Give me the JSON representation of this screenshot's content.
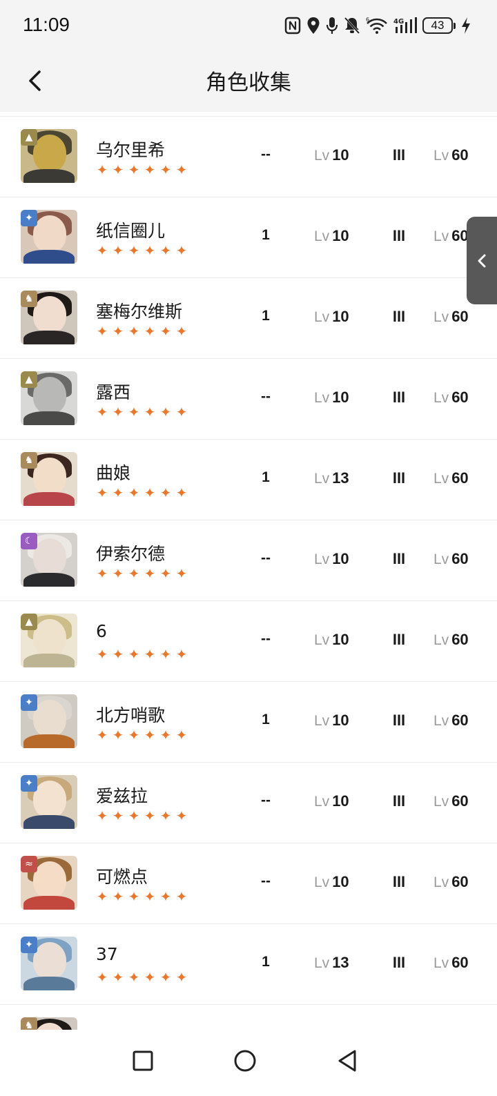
{
  "status_bar": {
    "time": "11:09",
    "battery": "43",
    "icons": [
      "nfc-icon",
      "location-icon",
      "microphone-icon",
      "bell-off-icon",
      "wifi-6-icon",
      "signal-4g-icon",
      "charging-icon"
    ]
  },
  "header": {
    "title": "角色收集",
    "back_icon": "chevron-left-icon"
  },
  "characters": [
    {
      "name": "乌尔里希",
      "stars": "★★★★★★",
      "dup": "--",
      "lv_prefix": "Lv",
      "level": "10",
      "phase": "III",
      "max_prefix": "Lv",
      "max_level": "60",
      "afflatus": "mineral-icon",
      "badge_color": "#9a8a4e",
      "badge_glyph": "▲",
      "bg": "#c9b98a",
      "hair": "#4b4632",
      "skin": "#c9a84a",
      "cloth": "#3b3a35"
    },
    {
      "name": "纸信圈儿",
      "stars": "★★★★★★",
      "dup": "1",
      "lv_prefix": "Lv",
      "level": "10",
      "phase": "III",
      "max_prefix": "Lv",
      "max_level": "60",
      "afflatus": "star-icon",
      "badge_color": "#4a7fc8",
      "badge_glyph": "✦",
      "bg": "#d9c7b8",
      "hair": "#8a5a4a",
      "skin": "#f1d9c8",
      "cloth": "#2f4d8a"
    },
    {
      "name": "塞梅尔维斯",
      "stars": "★★★★★★",
      "dup": "1",
      "lv_prefix": "Lv",
      "level": "10",
      "phase": "III",
      "max_prefix": "Lv",
      "max_level": "60",
      "afflatus": "beast-icon",
      "badge_color": "#a88a5c",
      "badge_glyph": "♞",
      "bg": "#cfc6bc",
      "hair": "#1e1a18",
      "skin": "#f0ddd0",
      "cloth": "#2a2626"
    },
    {
      "name": "露西",
      "stars": "★★★★★★",
      "dup": "--",
      "lv_prefix": "Lv",
      "level": "10",
      "phase": "III",
      "max_prefix": "Lv",
      "max_level": "60",
      "afflatus": "mineral-icon",
      "badge_color": "#9a8a4e",
      "badge_glyph": "▲",
      "bg": "#d8d8d6",
      "hair": "#6a6a68",
      "skin": "#b8b8b6",
      "cloth": "#4a4a48"
    },
    {
      "name": "曲娘",
      "stars": "★★★★★★",
      "dup": "1",
      "lv_prefix": "Lv",
      "level": "13",
      "phase": "III",
      "max_prefix": "Lv",
      "max_level": "60",
      "afflatus": "beast-icon",
      "badge_color": "#a88a5c",
      "badge_glyph": "♞",
      "bg": "#e5dccd",
      "hair": "#3b2620",
      "skin": "#f2ddc9",
      "cloth": "#b8454a"
    },
    {
      "name": "伊索尔德",
      "stars": "★★★★★★",
      "dup": "--",
      "lv_prefix": "Lv",
      "level": "10",
      "phase": "III",
      "max_prefix": "Lv",
      "max_level": "60",
      "afflatus": "spirit-icon",
      "badge_color": "#9a5cc0",
      "badge_glyph": "☾",
      "bg": "#d4d0cc",
      "hair": "#ece8e4",
      "skin": "#e8ddd6",
      "cloth": "#2b2b2e"
    },
    {
      "name": "6",
      "stars": "★★★★★★",
      "dup": "--",
      "lv_prefix": "Lv",
      "level": "10",
      "phase": "III",
      "max_prefix": "Lv",
      "max_level": "60",
      "afflatus": "mineral-icon",
      "badge_color": "#9a8a4e",
      "badge_glyph": "▲",
      "bg": "#ece6d2",
      "hair": "#cdbd88",
      "skin": "#efe2cc",
      "cloth": "#bcb492"
    },
    {
      "name": "北方哨歌",
      "stars": "★★★★★★",
      "dup": "1",
      "lv_prefix": "Lv",
      "level": "10",
      "phase": "III",
      "max_prefix": "Lv",
      "max_level": "60",
      "afflatus": "star-icon",
      "badge_color": "#4a7fc8",
      "badge_glyph": "✦",
      "bg": "#cfcac2",
      "hair": "#dad6cf",
      "skin": "#e9ddd0",
      "cloth": "#b86a2a"
    },
    {
      "name": "爱兹拉",
      "stars": "★★★★★★",
      "dup": "--",
      "lv_prefix": "Lv",
      "level": "10",
      "phase": "III",
      "max_prefix": "Lv",
      "max_level": "60",
      "afflatus": "star-icon",
      "badge_color": "#4a7fc8",
      "badge_glyph": "✦",
      "bg": "#d9cdb8",
      "hair": "#c7a97c",
      "skin": "#f3e2cf",
      "cloth": "#3a4a6a"
    },
    {
      "name": "可燃点",
      "stars": "★★★★★★",
      "dup": "--",
      "lv_prefix": "Lv",
      "level": "10",
      "phase": "III",
      "max_prefix": "Lv",
      "max_level": "60",
      "afflatus": "plant-icon",
      "badge_color": "#c0504a",
      "badge_glyph": "≈",
      "bg": "#e6d5c1",
      "hair": "#9a6a3a",
      "skin": "#f4dcc7",
      "cloth": "#c2473c"
    },
    {
      "name": "37",
      "stars": "★★★★★★",
      "dup": "1",
      "lv_prefix": "Lv",
      "level": "13",
      "phase": "III",
      "max_prefix": "Lv",
      "max_level": "60",
      "afflatus": "star-icon",
      "badge_color": "#4a7fc8",
      "badge_glyph": "✦",
      "bg": "#cbd8e2",
      "hair": "#7da2c4",
      "skin": "#eaded5",
      "cloth": "#5a7a9a"
    },
    {
      "name": "",
      "stars": "",
      "dup": "",
      "lv_prefix": "",
      "level": "",
      "phase": "",
      "max_prefix": "",
      "max_level": "",
      "afflatus": "beast-icon",
      "badge_color": "#a88a5c",
      "badge_glyph": "♞",
      "bg": "#d0c8c0",
      "hair": "#1e1a18",
      "skin": "#f0ddd0",
      "cloth": "#2a2626"
    }
  ],
  "side_tab": {
    "icon": "chevron-left-icon"
  },
  "nav_bar": {
    "buttons": [
      "recents-square-icon",
      "home-circle-icon",
      "back-triangle-icon"
    ]
  }
}
